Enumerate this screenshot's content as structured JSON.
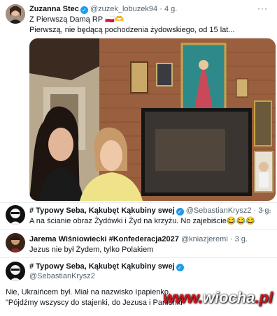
{
  "tweet1": {
    "name": "Zuzanna Stec",
    "handle": "@zuzek_lobuzek94",
    "time": "4 g.",
    "line1": "Z Pierwszą Damą RP 🇵🇱🫶",
    "line2": "Pierwszą,  nie będącą pochodzenia żydowskiego, od 15 lat..."
  },
  "tweet2": {
    "name": "# Typowy Seba, Kąkubęt Kąkubiny swej",
    "handle": "@SebastianKrysz2",
    "time": "3 g.",
    "text": "A na ścianie obraz Żydówki i Żyd na krzyżu. No zajebiście😂😂😂"
  },
  "tweet3": {
    "name": "Jarema Wiśniowiecki #Konfederacja2027",
    "handle": "@kniazjeremi",
    "time": "3 g.",
    "text": "Jezus nie był Żydem, tylko Polakiem"
  },
  "tweet4": {
    "name": "# Typowy Seba, Kąkubęt Kąkubiny swej",
    "handle": "@SebastianKrysz2",
    "line1": "Nie, Ukraińcem był. Miał na nazwisko Ipapienko.",
    "line2": "\"Pójdźmy wszyscy do stajenki, do Jezusa i Panienki\""
  },
  "ui": {
    "dot": "·",
    "more": "···",
    "check": "✓"
  },
  "watermark": {
    "www": "www.",
    "site": "wiocha",
    "tld": ".pl"
  }
}
